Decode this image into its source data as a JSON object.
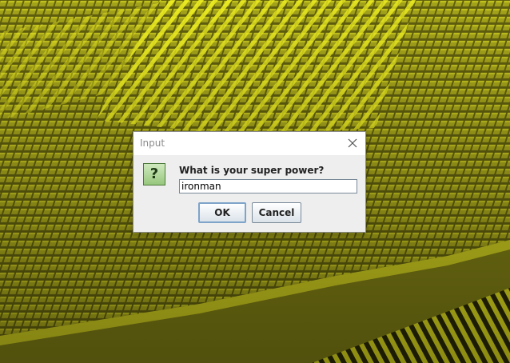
{
  "dialog": {
    "title": "Input",
    "question_icon": "?",
    "prompt": "What is your super power?",
    "input_value": "ironman",
    "ok_label": "OK",
    "cancel_label": "Cancel"
  },
  "colors": {
    "wallpaper_base": "#6b6a10",
    "wallpaper_highlight": "#eaea20",
    "dialog_bg": "#eeeeee",
    "title_text": "#8c8c8c",
    "icon_green": "#97c77d"
  },
  "icons": {
    "close": "close-icon",
    "question": "question-icon"
  }
}
